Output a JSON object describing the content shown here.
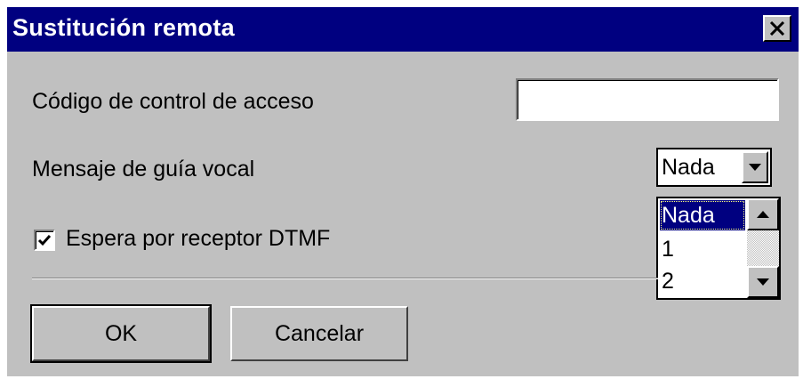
{
  "window": {
    "title": "Sustitución remota",
    "close_icon": "close-x-icon"
  },
  "form": {
    "access_code": {
      "label": "Código de control de acceso",
      "value": ""
    },
    "voice_guide": {
      "label": "Mensaje de guía vocal",
      "selected": "Nada",
      "options": [
        "Nada",
        "1",
        "2"
      ],
      "dropdown_icon": "chevron-down-icon"
    },
    "dtmf": {
      "label": "Espera por receptor  DTMF",
      "checked": true
    }
  },
  "buttons": {
    "ok": "OK",
    "cancel": "Cancelar"
  },
  "colors": {
    "titlebar": "#000080",
    "face": "#c0c0c0",
    "selection": "#000080"
  }
}
